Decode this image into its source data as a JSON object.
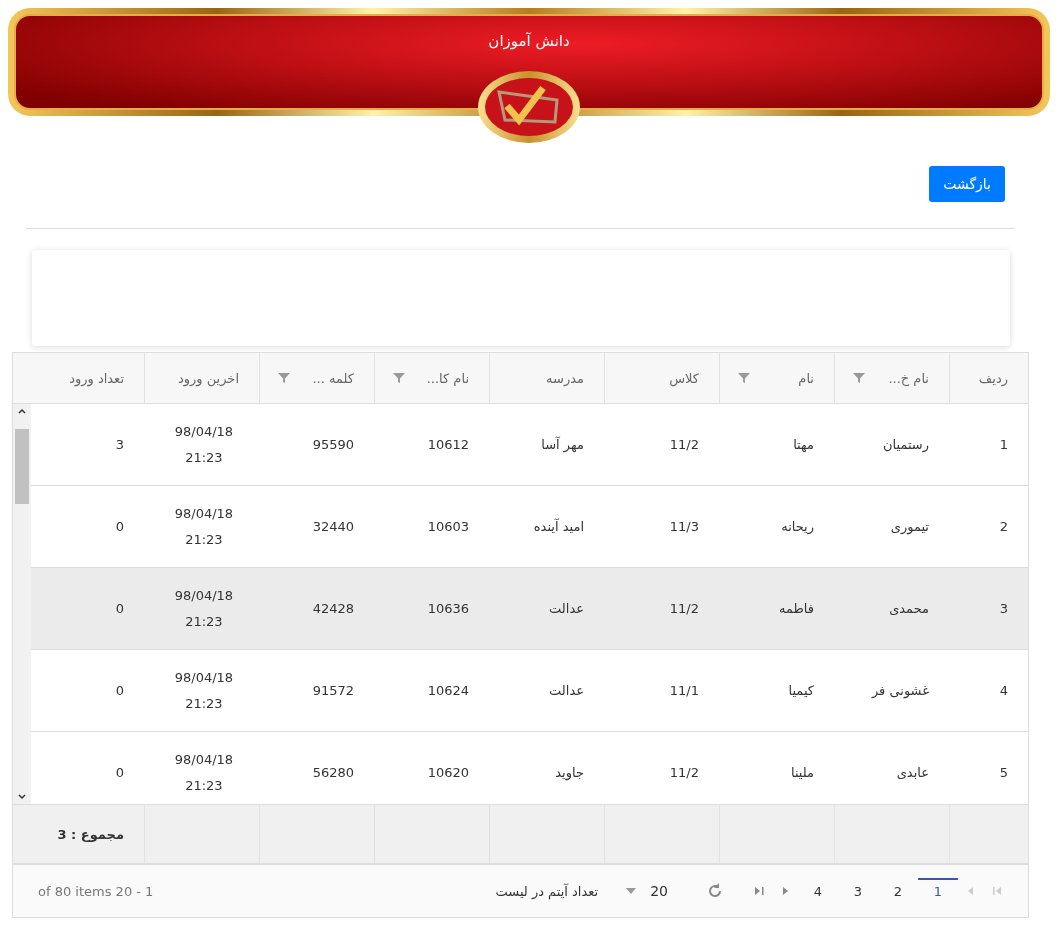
{
  "banner": {
    "title": "دانش آموزان"
  },
  "back_button": "بازگشت",
  "table": {
    "columns": [
      {
        "label": "ردیف",
        "filter": false
      },
      {
        "label": "نام خ...",
        "filter": true
      },
      {
        "label": "نام",
        "filter": true
      },
      {
        "label": "کلاس",
        "filter": false
      },
      {
        "label": "مدرسه",
        "filter": false
      },
      {
        "label": "نام کا...",
        "filter": true
      },
      {
        "label": "کلمه ...",
        "filter": true
      },
      {
        "label": "اخرین ورود",
        "filter": false
      },
      {
        "label": "تعداد ورود",
        "filter": false
      }
    ],
    "rows": [
      {
        "cells": [
          "1",
          "رستمیان",
          "مهتا",
          "11/2",
          "مهر آسا",
          "10612",
          "95590",
          "98/04/18 21:23",
          "3"
        ],
        "selected": false
      },
      {
        "cells": [
          "2",
          "تیموری",
          "ریحانه",
          "11/3",
          "امید آینده",
          "10603",
          "32440",
          "98/04/18 21:23",
          "0"
        ],
        "selected": false
      },
      {
        "cells": [
          "3",
          "محمدی",
          "فاطمه",
          "11/2",
          "عدالت",
          "10636",
          "42428",
          "98/04/18 21:23",
          "0"
        ],
        "selected": true
      },
      {
        "cells": [
          "4",
          "غشونی فر",
          "کیمیا",
          "11/1",
          "عدالت",
          "10624",
          "91572",
          "98/04/18 21:23",
          "0"
        ],
        "selected": false
      },
      {
        "cells": [
          "5",
          "عابدی",
          "ملینا",
          "11/2",
          "جاوید",
          "10620",
          "56280",
          "98/04/18 21:23",
          "0"
        ],
        "selected": false
      }
    ],
    "total": "مجموع : 3"
  },
  "pager": {
    "pages": [
      {
        "label": "1",
        "selected": true
      },
      {
        "label": "2",
        "selected": false
      },
      {
        "label": "3",
        "selected": false
      },
      {
        "label": "4",
        "selected": false
      }
    ],
    "page_size": "20",
    "page_size_label": "تعداد آیتم در لیست",
    "info": "of 80 items 20 - 1"
  }
}
